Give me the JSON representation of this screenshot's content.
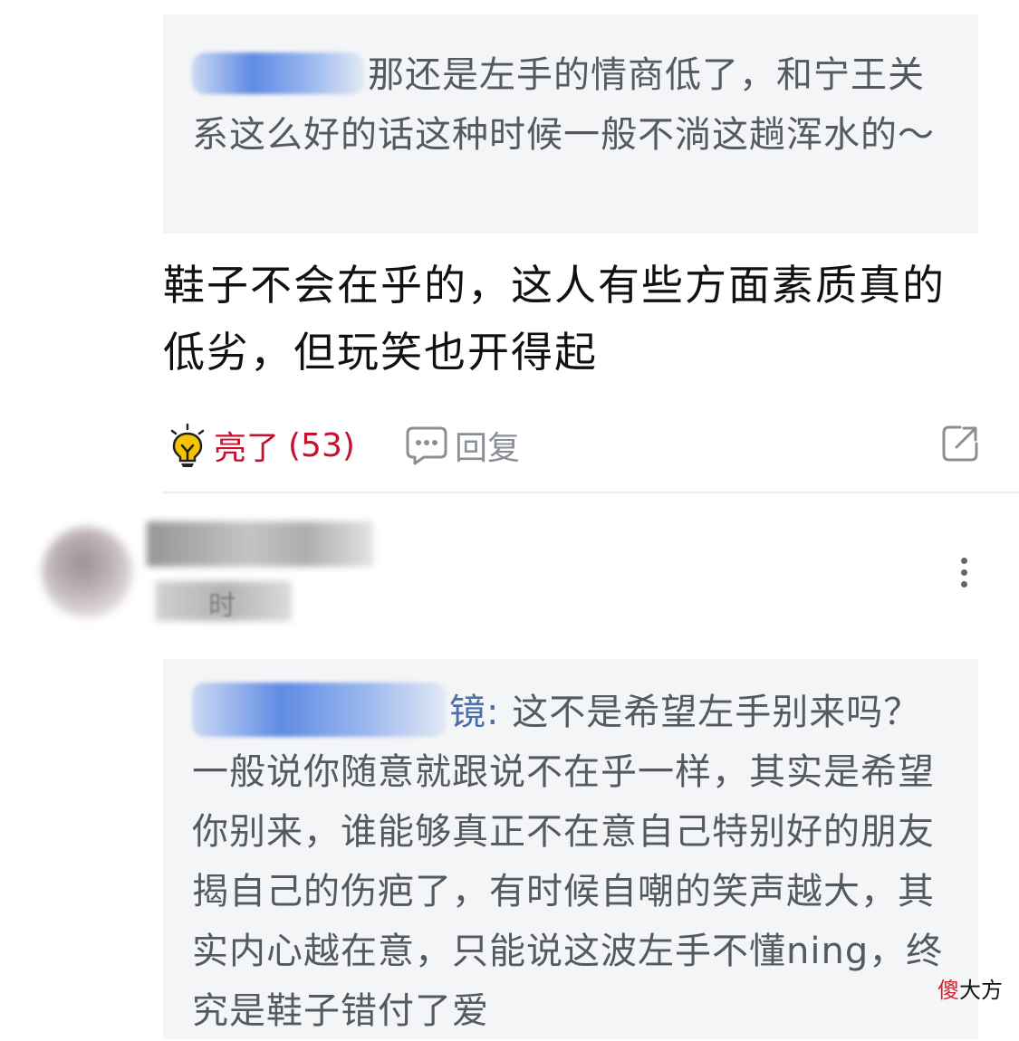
{
  "thread": {
    "quoted_reply_1": {
      "text": "那还是左手的情商低了，和宁王关系这么好的话这种时候一般不淌这趟浑水的～"
    },
    "comment": {
      "body": "鞋子不会在乎的，这人有些方面素质真的低劣，但玩笑也开得起"
    },
    "actions": {
      "like_label": "亮了",
      "like_count": "(53)",
      "reply_label": "回复",
      "like_icon": "lightbulb-icon",
      "reply_icon": "chat-bubble-icon",
      "share_icon": "share-icon"
    },
    "next_comment": {
      "meta_visible": "时",
      "more_icon": "more-vertical-icon",
      "quoted_reply_2": {
        "author_suffix": "镜:",
        "text": "这不是希望左手别来吗？一般说你随意就跟说不在乎一样，其实是希望你别来，谁能够真正不在意自己特别好的朋友揭自己的伤疤了，有时候自嘲的笑声越大，其实内心越在意，只能说这波左手不懂ning，终究是鞋子错付了爱"
      }
    }
  },
  "watermark": {
    "accent": "傻",
    "rest": "大方"
  },
  "colors": {
    "like_red": "#c8102e",
    "bulb_yellow": "#f5c400",
    "quote_bg": "#f4f5f7",
    "author_blue": "#4b6fa8"
  }
}
